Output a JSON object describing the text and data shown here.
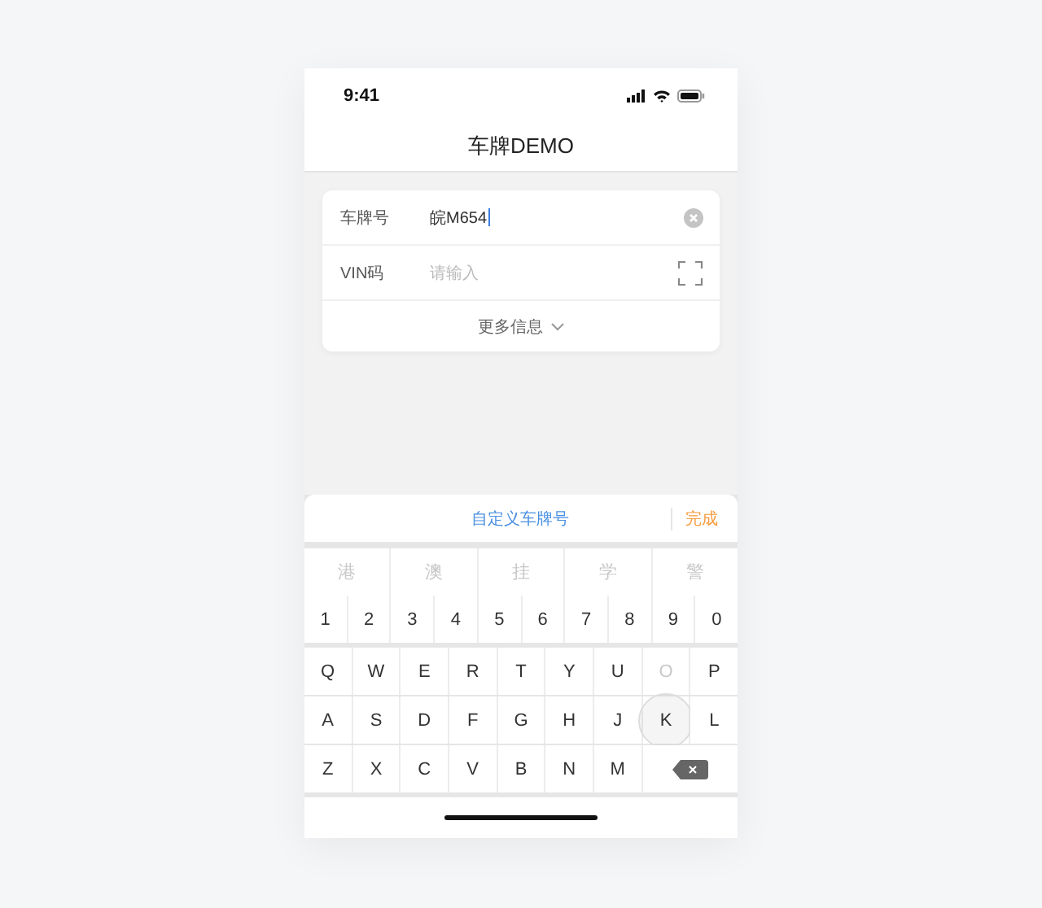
{
  "status_bar": {
    "time": "9:41"
  },
  "nav": {
    "title": "车牌DEMO"
  },
  "form": {
    "fields": [
      {
        "label": "车牌号",
        "value": "皖M654",
        "kind": "clearable",
        "focused": true
      },
      {
        "label": "VIN码",
        "placeholder": "请输入",
        "kind": "scan",
        "focused": false
      }
    ],
    "more": "更多信息"
  },
  "keyboard": {
    "custom": "自定义车牌号",
    "done": "完成",
    "special_keys": [
      {
        "label": "港",
        "disabled": true
      },
      {
        "label": "澳",
        "disabled": true
      },
      {
        "label": "挂",
        "disabled": true
      },
      {
        "label": "学",
        "disabled": true
      },
      {
        "label": "警",
        "disabled": true
      }
    ],
    "digit_keys": [
      {
        "label": "1",
        "disabled": false
      },
      {
        "label": "2",
        "disabled": false
      },
      {
        "label": "3",
        "disabled": false
      },
      {
        "label": "4",
        "disabled": false
      },
      {
        "label": "5",
        "disabled": false
      },
      {
        "label": "6",
        "disabled": false
      },
      {
        "label": "7",
        "disabled": false
      },
      {
        "label": "8",
        "disabled": false
      },
      {
        "label": "9",
        "disabled": false
      },
      {
        "label": "0",
        "disabled": false
      }
    ],
    "letter_rows": [
      {
        "keys": [
          {
            "kind": "char",
            "label": "Q",
            "disabled": false,
            "pressed": false
          },
          {
            "kind": "char",
            "label": "W",
            "disabled": false,
            "pressed": false
          },
          {
            "kind": "char",
            "label": "E",
            "disabled": false,
            "pressed": false
          },
          {
            "kind": "char",
            "label": "R",
            "disabled": false,
            "pressed": false
          },
          {
            "kind": "char",
            "label": "T",
            "disabled": false,
            "pressed": false
          },
          {
            "kind": "char",
            "label": "Y",
            "disabled": false,
            "pressed": false
          },
          {
            "kind": "char",
            "label": "U",
            "disabled": false,
            "pressed": false
          },
          {
            "kind": "char",
            "label": "O",
            "disabled": true,
            "pressed": false
          },
          {
            "kind": "char",
            "label": "P",
            "disabled": false,
            "pressed": false
          }
        ]
      },
      {
        "keys": [
          {
            "kind": "char",
            "label": "A",
            "disabled": false,
            "pressed": false
          },
          {
            "kind": "char",
            "label": "S",
            "disabled": false,
            "pressed": false
          },
          {
            "kind": "char",
            "label": "D",
            "disabled": false,
            "pressed": false
          },
          {
            "kind": "char",
            "label": "F",
            "disabled": false,
            "pressed": false
          },
          {
            "kind": "char",
            "label": "G",
            "disabled": false,
            "pressed": false
          },
          {
            "kind": "char",
            "label": "H",
            "disabled": false,
            "pressed": false
          },
          {
            "kind": "char",
            "label": "J",
            "disabled": false,
            "pressed": false
          },
          {
            "kind": "char",
            "label": "K",
            "disabled": false,
            "pressed": true
          },
          {
            "kind": "char",
            "label": "L",
            "disabled": false,
            "pressed": false
          }
        ]
      },
      {
        "keys": [
          {
            "kind": "char",
            "label": "Z",
            "disabled": false,
            "pressed": false
          },
          {
            "kind": "char",
            "label": "X",
            "disabled": false,
            "pressed": false
          },
          {
            "kind": "char",
            "label": "C",
            "disabled": false,
            "pressed": false
          },
          {
            "kind": "char",
            "label": "V",
            "disabled": false,
            "pressed": false
          },
          {
            "kind": "char",
            "label": "B",
            "disabled": false,
            "pressed": false
          },
          {
            "kind": "char",
            "label": "N",
            "disabled": false,
            "pressed": false
          },
          {
            "kind": "char",
            "label": "M",
            "disabled": false,
            "pressed": false
          },
          {
            "kind": "delete",
            "disabled": false,
            "pressed": false
          }
        ]
      }
    ]
  }
}
